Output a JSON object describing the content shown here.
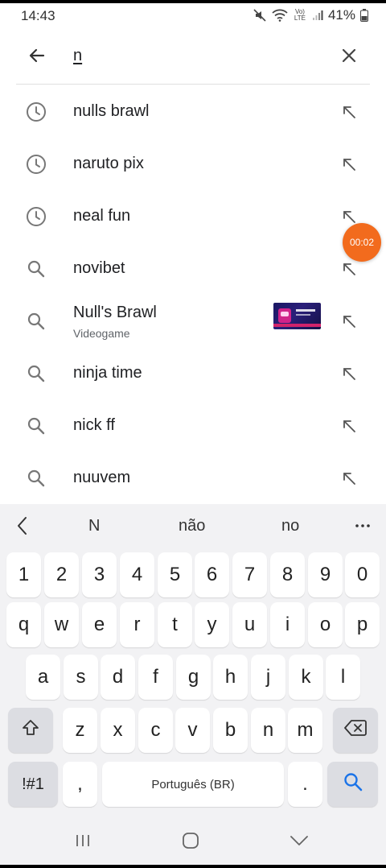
{
  "status_bar": {
    "time": "14:43",
    "network_label": "Vo) LTE",
    "battery": "41%"
  },
  "search": {
    "query": "n",
    "back_icon": "arrow-left-icon",
    "clear_icon": "close-icon"
  },
  "suggestions": [
    {
      "type": "history",
      "icon": "history-clock-icon",
      "text": "nulls brawl"
    },
    {
      "type": "history",
      "icon": "history-clock-icon",
      "text": "naruto pix"
    },
    {
      "type": "history",
      "icon": "history-clock-icon",
      "text": "neal fun"
    },
    {
      "type": "search",
      "icon": "search-icon",
      "text": "novibet"
    },
    {
      "type": "app",
      "icon": "search-icon",
      "text": "Null's Brawl",
      "subtitle": "Videogame"
    },
    {
      "type": "search",
      "icon": "search-icon",
      "text": "ninja time"
    },
    {
      "type": "search",
      "icon": "search-icon",
      "text": "nick ff"
    },
    {
      "type": "search",
      "icon": "search-icon",
      "text": "nuuvem"
    }
  ],
  "recording_timer": "00:02",
  "keyboard": {
    "predictions": [
      "N",
      "não",
      "no"
    ],
    "number_row": [
      "1",
      "2",
      "3",
      "4",
      "5",
      "6",
      "7",
      "8",
      "9",
      "0"
    ],
    "row1": [
      "q",
      "w",
      "e",
      "r",
      "t",
      "y",
      "u",
      "i",
      "o",
      "p"
    ],
    "row2": [
      "a",
      "s",
      "d",
      "f",
      "g",
      "h",
      "j",
      "k",
      "l"
    ],
    "row3": [
      "z",
      "x",
      "c",
      "v",
      "b",
      "n",
      "m"
    ],
    "symbols_label": "!#1",
    "comma": ",",
    "space_label": "Português (BR)",
    "period": "."
  },
  "colors": {
    "accent": "#1a73e8",
    "timer": "#f26b1d",
    "keyboard_bg": "#f2f2f4"
  }
}
